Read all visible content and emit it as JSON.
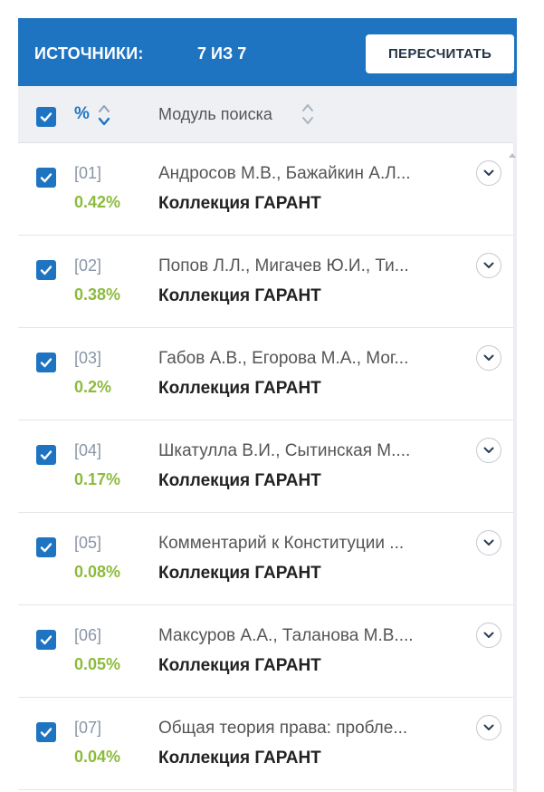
{
  "header": {
    "title": "ИСТОЧНИКИ:",
    "count": "7 ИЗ 7",
    "recalc_label": "ПЕРЕСЧИТАТЬ"
  },
  "columns": {
    "percent": "%",
    "module": "Модуль поиска"
  },
  "colors": {
    "accent": "#1f74c1",
    "percent_green": "#8dbb3e"
  },
  "sources": [
    {
      "index": "[01]",
      "percent": "0.42%",
      "name": "Андросов М.В., Бажайкин А.Л...",
      "collection": "Коллекция ГАРАНТ",
      "checked": true
    },
    {
      "index": "[02]",
      "percent": "0.38%",
      "name": "Попов Л.Л., Мигачев Ю.И., Ти...",
      "collection": "Коллекция ГАРАНТ",
      "checked": true
    },
    {
      "index": "[03]",
      "percent": "0.2%",
      "name": "Габов А.В., Егорова М.А., Мог...",
      "collection": "Коллекция ГАРАНТ",
      "checked": true
    },
    {
      "index": "[04]",
      "percent": "0.17%",
      "name": "Шкатулла В.И., Сытинская М....",
      "collection": "Коллекция ГАРАНТ",
      "checked": true
    },
    {
      "index": "[05]",
      "percent": "0.08%",
      "name": "Комментарий к Конституции ...",
      "collection": "Коллекция ГАРАНТ",
      "checked": true
    },
    {
      "index": "[06]",
      "percent": "0.05%",
      "name": "Максуров А.А., Таланова М.В....",
      "collection": "Коллекция ГАРАНТ",
      "checked": true
    },
    {
      "index": "[07]",
      "percent": "0.04%",
      "name": "Общая теория права: пробле...",
      "collection": "Коллекция ГАРАНТ",
      "checked": true
    }
  ]
}
